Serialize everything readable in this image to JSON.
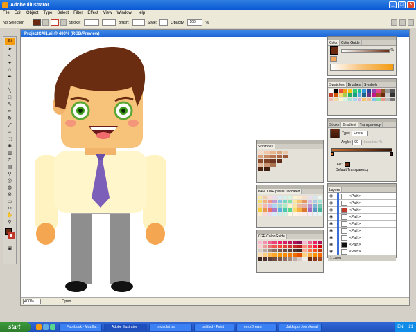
{
  "window": {
    "title": "Adobe Illustrator"
  },
  "menu": [
    "File",
    "Edit",
    "Object",
    "Type",
    "Select",
    "Filter",
    "Effect",
    "View",
    "Window",
    "Help"
  ],
  "control": {
    "selection": "No Selection",
    "stroke_label": "Stroke:",
    "brush_label": "Brush:",
    "style_label": "Style:",
    "opacity_label": "Opacity:",
    "opacity_value": "100",
    "opacity_unit": "%"
  },
  "tools": {
    "logo": "Ai"
  },
  "document": {
    "title": "ProjectCAI1.ai @ 400% (RGB/Preview)",
    "zoom": "400%",
    "status": "Open"
  },
  "panels": {
    "color": {
      "tabs": [
        "Color",
        "Color Guide"
      ],
      "percent": "%"
    },
    "swatches": {
      "tabs": [
        "Swatches",
        "Brushes",
        "Symbols"
      ]
    },
    "gradient": {
      "tabs": [
        "Stroke",
        "Gradient",
        "Transparency"
      ],
      "type_label": "Type:",
      "type_value": "Linear",
      "angle_label": "Angle:",
      "angle_value": "90",
      "location_label": "Location:",
      "location_unit": "%",
      "fill_label": "Fill:",
      "default_transparency": "Default Transparency"
    },
    "skintones": {
      "tabs": [
        "Skintones"
      ]
    },
    "pantone": {
      "tabs": [
        "PANTONE pastel uncoated"
      ]
    },
    "colorguide": {
      "tabs": [
        "CGE Color Guide"
      ]
    },
    "layers": {
      "tabs": [
        "Layers"
      ],
      "rows": [
        "<Path>",
        "<Path>",
        "<Path>",
        "<Path>",
        "<Path>",
        "<Path>",
        "<Path>",
        "<Path>",
        "<Path>",
        "<Path>"
      ],
      "footer": "1 Layer"
    }
  },
  "taskbar": {
    "start": "start",
    "tasks": [
      "Facebook - Mozilla...",
      "Adobe Illustrator",
      "phuaolai bia",
      "untitled - Paint",
      "errorDream",
      "Jakkapol Joemkanal"
    ],
    "tray": "EN",
    "clock": "21"
  },
  "colors": {
    "fill": "#6b2a10",
    "stroke": "#c0392b",
    "accent": "#0a58d6",
    "hair": "#6b2d12",
    "skin": "#f7c27a",
    "shirt": "#fff6cc",
    "tie": "#7b5fb8",
    "pants": "#8e8e8e"
  }
}
